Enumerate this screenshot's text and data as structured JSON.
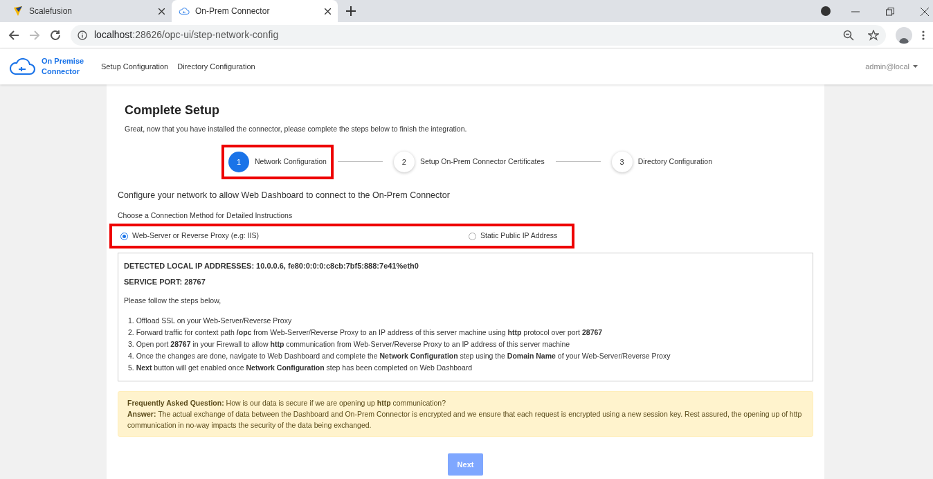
{
  "browser": {
    "tabs": [
      {
        "title": "Scalefusion",
        "selected": false
      },
      {
        "title": "On-Prem Connector",
        "selected": true
      }
    ],
    "url_host": "localhost",
    "url_path": ":28626/opc-ui/step-network-config"
  },
  "header": {
    "logo_text": "On Premise Connector",
    "nav": [
      "Setup Configuration",
      "Directory Configuration"
    ],
    "user": "admin@local"
  },
  "page": {
    "title": "Complete Setup",
    "subtitle": "Great, now that you have installed the connector, please complete the steps below to finish the integration.",
    "steps": [
      {
        "number": "1",
        "label": "Network Configuration",
        "selected": true,
        "highlighted": true
      },
      {
        "number": "2",
        "label": "Setup On-Prem Connector Certificates",
        "selected": false,
        "highlighted": false
      },
      {
        "number": "3",
        "label": "Directory Configuration",
        "selected": false,
        "highlighted": false
      }
    ],
    "section_title": "Configure your network to allow Web Dashboard to connect to the On-Prem Connector",
    "method_label": "Choose a Connection Method for Detailed Instructions",
    "methods_highlighted": true,
    "methods": [
      {
        "label": "Web-Server or Reverse Proxy (e.g: IIS)",
        "selected": true
      },
      {
        "label": "Static Public IP Address",
        "selected": false
      }
    ],
    "info": {
      "detected": "DETECTED LOCAL IP ADDRESSES: 10.0.0.6, fe80:0:0:0:c8cb:7bf5:888:7e41%eth0",
      "port": "SERVICE PORT: 28767",
      "intro": "Please follow the steps below,",
      "steps": [
        "1. Offload SSL on your Web-Server/Reverse Proxy",
        "2. Forward traffic for context path **/opc** from Web-Server/Reverse Proxy to an IP address of this server machine using **http** protocol over port **28767**",
        "3. Open port **28767** in your Firewall to allow **http** communication from Web-Server/Reverse Proxy to an IP address of this server machine",
        "4. Once the changes are done, navigate to Web Dashboard and complete the **Network Configuration** step using the **Domain Name** of your Web-Server/Reverse Proxy",
        "5. **Next** button will get enabled once **Network Configuration** step has been completed on Web Dashboard"
      ]
    },
    "faq": {
      "question": "**Frequently Asked Question:** How is our data is secure if we are opening up **http** communication?",
      "answer": "**Answer:** The actual exchange of data between the Dashboard and On-Prem Connector is encrypted and we ensure that each request is encrypted using a new session key. Rest assured, the opening up of http communication in no-way impacts the security of the data being exchanged."
    },
    "next": {
      "label": "Next",
      "disabled": true
    }
  }
}
